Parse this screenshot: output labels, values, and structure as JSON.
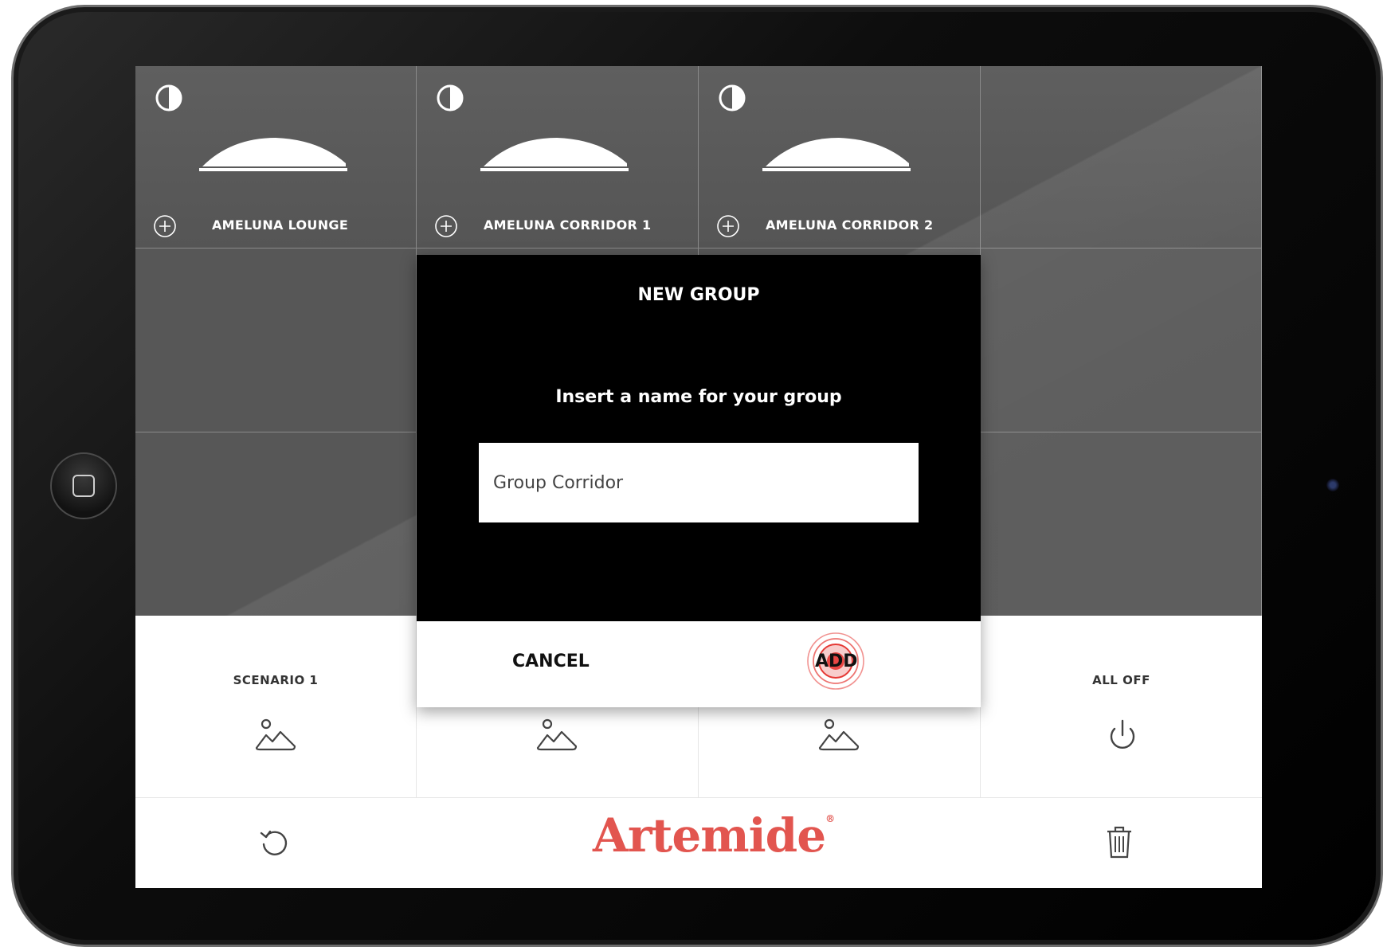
{
  "tiles": [
    {
      "label": "AMELUNA LOUNGE"
    },
    {
      "label": "AMELUNA CORRIDOR 1"
    },
    {
      "label": "AMELUNA CORRIDOR 2"
    }
  ],
  "dialog": {
    "title": "NEW GROUP",
    "prompt": "Insert a name for your group",
    "input_value": "Group Corridor",
    "cancel_label": "CANCEL",
    "add_label": "ADD"
  },
  "scenarios": [
    {
      "label": "SCENARIO 1"
    },
    {
      "label": ""
    },
    {
      "label": ""
    },
    {
      "label": "ALL OFF"
    }
  ],
  "footer": {
    "brand": "Artemide",
    "brand_mark": "®"
  },
  "colors": {
    "brand": "#e2554f",
    "tile_bg": "#5b5b5b",
    "dialog_bg": "#000000",
    "tap_ripple": "#e53935"
  },
  "icons": {
    "dim": "half-circle-dimmer-icon",
    "add": "plus-circle-icon",
    "lamp": "ameluna-lamp-icon",
    "scenario": "landscape-scenario-icon",
    "power": "power-icon",
    "reset": "refresh-icon",
    "delete": "trash-icon"
  }
}
